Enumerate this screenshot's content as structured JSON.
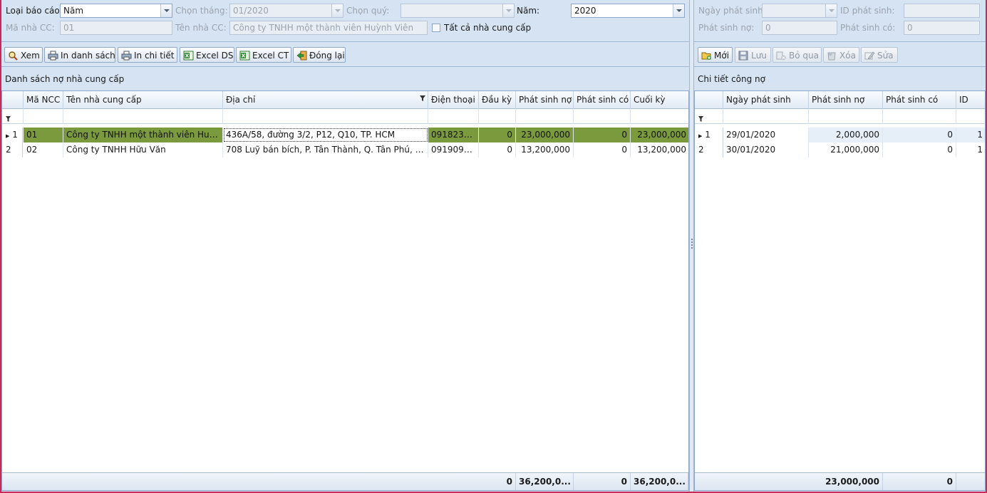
{
  "filters": {
    "report_type_label": "Loại báo cáo:",
    "report_type_value": "Năm",
    "month_label": "Chọn tháng:",
    "month_value": "01/2020",
    "quarter_label": "Chọn quý:",
    "quarter_value": "",
    "year_label": "Năm:",
    "year_value": "2020",
    "supplier_code_label": "Mã nhà CC:",
    "supplier_code_value": "01",
    "supplier_name_label": "Tên nhà CC:",
    "supplier_name_value": "Công ty TNHH một thành viên Huỳnh Viên",
    "all_suppliers_label": "Tất cả nhà cung cấp"
  },
  "left_toolbar": {
    "view": "Xem",
    "print_list": "In danh sách",
    "print_detail": "In chi tiết",
    "excel_ds": "Excel DS",
    "excel_ct": "Excel CT",
    "close": "Đóng lại"
  },
  "supplier_grid": {
    "title": "Danh sách nợ nhà cung cấp",
    "columns": [
      "Mã NCC",
      "Tên nhà cung cấp",
      "Địa chỉ",
      "Điện thoại",
      "Đầu kỳ",
      "Phát sinh nợ",
      "Phát sinh có",
      "Cuối kỳ"
    ],
    "rows": [
      {
        "indicator": "1",
        "code": "01",
        "name": "Công ty TNHH một thành viên Huỳn...",
        "address": "436A/58, đường 3/2, P12, Q10, TP. HCM",
        "phone": "0918239...",
        "opening": "0",
        "debit": "23,000,000",
        "credit": "0",
        "closing": "23,000,000"
      },
      {
        "indicator": "2",
        "code": "02",
        "name": "Công ty TNHH Hữu Văn",
        "address": "708 Luỹ bán bích, P. Tân Thành, Q. Tân Phú, T...",
        "phone": "0919092...",
        "opening": "0",
        "debit": "13,200,000",
        "credit": "0",
        "closing": "13,200,000"
      }
    ],
    "footer": {
      "opening": "0",
      "debit": "36,200,0...",
      "credit": "0",
      "closing": "36,200,0..."
    }
  },
  "detail_form": {
    "date_label": "Ngày phát sinh:",
    "date_value": "",
    "id_label": "ID phát sinh:",
    "id_value": "",
    "debit_label": "Phát sinh nợ:",
    "debit_value": "0",
    "credit_label": "Phát sinh có:",
    "credit_value": "0"
  },
  "right_toolbar": {
    "new": "Mới",
    "save": "Lưu",
    "skip": "Bỏ qua",
    "delete": "Xóa",
    "edit": "Sửa"
  },
  "detail_grid": {
    "title": "Chi tiết công nợ",
    "columns": [
      "Ngày phát sinh",
      "Phát sinh nợ",
      "Phát sinh có",
      "ID"
    ],
    "rows": [
      {
        "indicator": "1",
        "date": "29/01/2020",
        "debit": "2,000,000",
        "credit": "0",
        "id": "1"
      },
      {
        "indicator": "2",
        "date": "30/01/2020",
        "debit": "21,000,000",
        "credit": "0",
        "id": "1"
      }
    ],
    "footer": {
      "debit": "23,000,000",
      "credit": "0"
    }
  },
  "colors": {
    "selected_row": "#7b9a3e",
    "panel_bg": "#d6e3f3",
    "frame": "#c8285a"
  }
}
